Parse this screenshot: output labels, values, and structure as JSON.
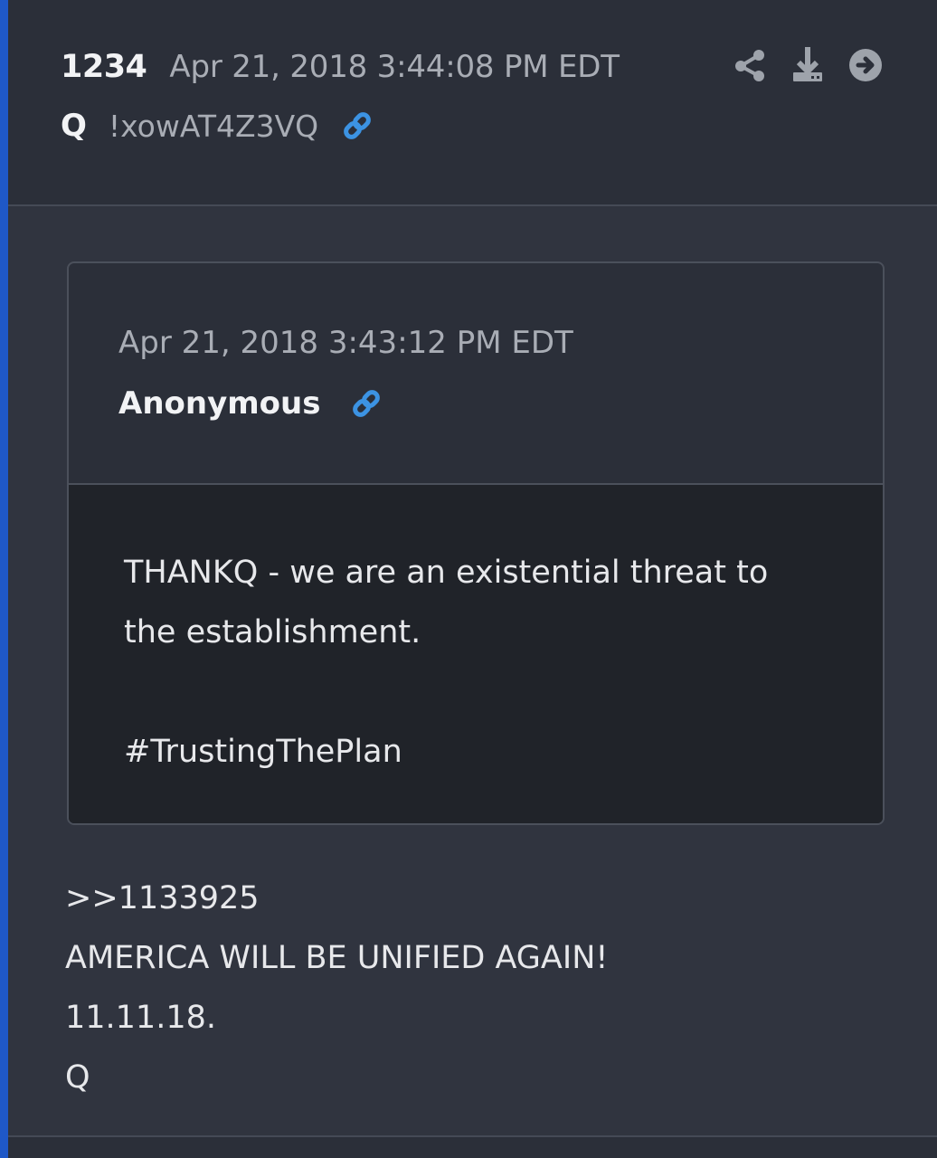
{
  "post": {
    "number": "1234",
    "timestamp": "Apr 21, 2018 3:44:08 PM EDT",
    "author": "Q",
    "tripcode": "!xowAT4Z3VQ",
    "icons": {
      "link": "link-icon",
      "share": "share-icon",
      "download": "download-icon",
      "next": "arrow-right-circle-icon"
    }
  },
  "quote": {
    "timestamp": "Apr 21, 2018 3:43:12 PM EDT",
    "author": "Anonymous",
    "text": "THANKQ - we are an existential threat to\nthe establishment.\n\n#TrustingThePlan"
  },
  "reply": {
    "lines": [
      ">>1133925",
      "AMERICA WILL BE UNIFIED AGAIN!",
      "11.11.18.",
      "Q"
    ]
  },
  "colors": {
    "background": "#30343f",
    "header": "#2b2f39",
    "quote_body": "#202329",
    "accent": "#1f58c7",
    "link_icon": "#3c93e3"
  }
}
